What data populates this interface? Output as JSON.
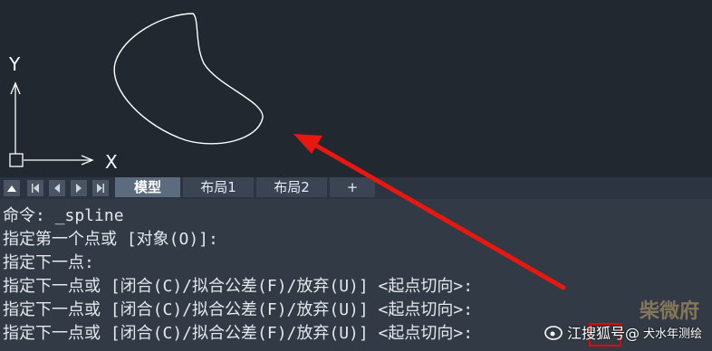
{
  "canvas": {
    "ucs_y_label": "Y",
    "ucs_x_label": "X",
    "spline_color": "#ffffff",
    "arrow_color": "#e8170f"
  },
  "tabbar": {
    "nav_icons": [
      "arrow-up-icon",
      "first-icon",
      "prev-icon",
      "next-icon",
      "last-icon"
    ],
    "tabs": [
      {
        "label": "模型",
        "active": true
      },
      {
        "label": "布局1",
        "active": false
      },
      {
        "label": "布局2",
        "active": false
      },
      {
        "label": "+",
        "active": false
      }
    ]
  },
  "command_history": [
    "命令: _spline",
    "指定第一个点或 [对象(O)]:",
    "指定下一点:",
    "指定下一点或 [闭合(C)/拟合公差(F)/放弃(U)] <起点切向>:",
    "指定下一点或 [闭合(C)/拟合公差(F)/放弃(U)] <起点切向>:",
    "指定下一点或 [闭合(C)/拟合公差(F)/放弃(U)] <起点切向>:"
  ],
  "watermark": {
    "handle": "江搜狐号@",
    "name": "犬水年测绘",
    "corner": "柴微府"
  }
}
